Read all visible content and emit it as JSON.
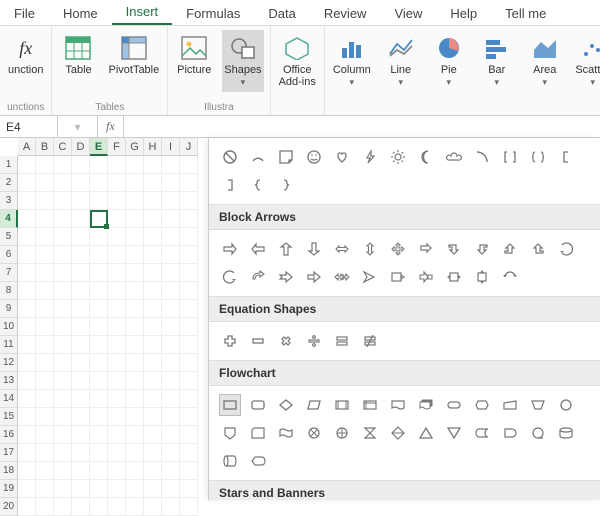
{
  "tabs": [
    "File",
    "Home",
    "Insert",
    "Formulas",
    "Data",
    "Review",
    "View",
    "Help",
    "Tell me"
  ],
  "active_tab": "Insert",
  "ribbon": {
    "fx": "fx",
    "function_lbl": "unction",
    "table": "Table",
    "pivot": "PivotTable",
    "tables_grp": "Tables",
    "picture": "Picture",
    "shapes": "Shapes",
    "illust_grp": "Illustra",
    "addins": "Office\nAdd-ins",
    "column": "Column",
    "line": "Line",
    "pie": "Pie",
    "bar": "Bar",
    "area": "Area",
    "scatter": "Scatter",
    "functions_grp": "unctions"
  },
  "formula": {
    "cell_ref": "E4",
    "fx": "fx",
    "value": ""
  },
  "grid": {
    "cols": [
      "A",
      "B",
      "C",
      "D",
      "E",
      "F",
      "G",
      "H",
      "I",
      "J"
    ],
    "rows": 20,
    "active_col": 4,
    "active_row": 3
  },
  "shape_categories": {
    "block_arrows": "Block Arrows",
    "equation": "Equation Shapes",
    "flowchart": "Flowchart",
    "stars": "Stars and Banners"
  }
}
